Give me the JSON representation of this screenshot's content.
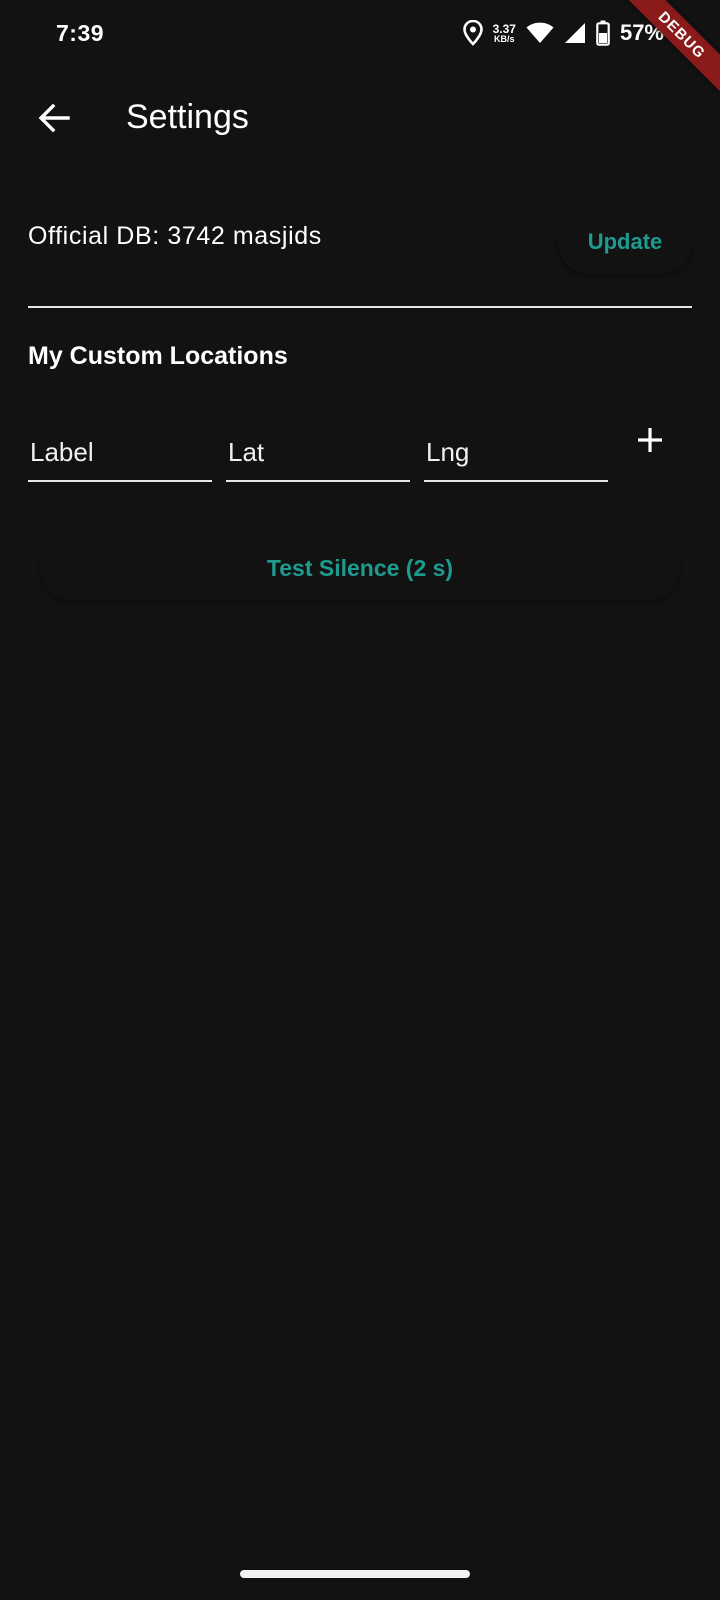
{
  "status_bar": {
    "time": "7:39",
    "net_speed_value": "3.37",
    "net_speed_unit": "KB/s",
    "battery": "57%",
    "icons": [
      "location-icon",
      "wifi-icon",
      "signal-icon",
      "battery-icon"
    ]
  },
  "debug_banner": "DEBUG",
  "app_bar": {
    "back_icon": "arrow-back-icon",
    "title": "Settings"
  },
  "official_db": {
    "text": "Official DB: 3742 masjids",
    "update_label": "Update"
  },
  "custom_locations": {
    "heading": "My Custom Locations",
    "label_placeholder": "Label",
    "lat_placeholder": "Lat",
    "lng_placeholder": "Lng",
    "add_icon": "plus-icon"
  },
  "test_silence_label": "Test Silence (2 s)",
  "colors": {
    "background": "#121212",
    "accent": "#1e9b8f",
    "debug_ribbon": "#8b1a1a"
  }
}
